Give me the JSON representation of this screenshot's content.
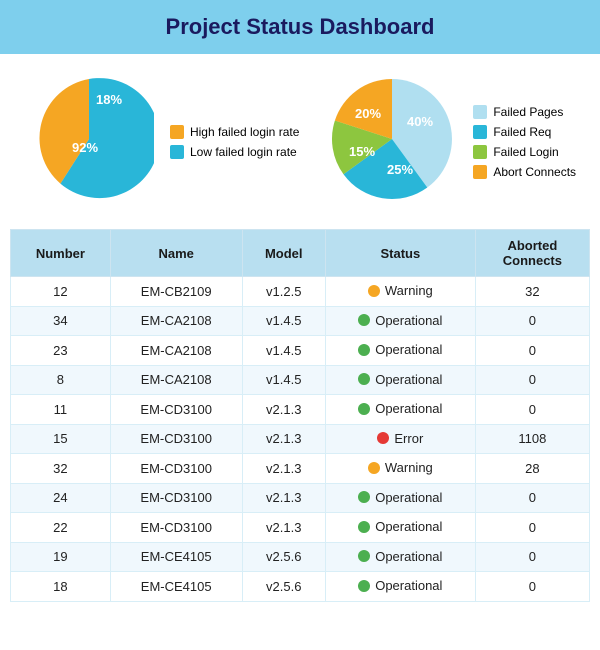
{
  "header": {
    "title": "Project Status Dashboard"
  },
  "chart1": {
    "slices": [
      {
        "label": "High failed login rate",
        "percent": 18,
        "color": "#f5a623"
      },
      {
        "label": "Low failed login rate",
        "percent": 92,
        "color": "#29b6d8"
      }
    ],
    "legend": [
      {
        "label": "High failed login rate",
        "color": "#f5a623"
      },
      {
        "label": "Low failed login rate",
        "color": "#29b6d8"
      }
    ]
  },
  "chart2": {
    "slices": [
      {
        "label": "Failed Pages",
        "percent": 40,
        "color": "#b0dff0"
      },
      {
        "label": "Failed Req",
        "percent": 25,
        "color": "#29b6d8"
      },
      {
        "label": "Failed Login",
        "percent": 15,
        "color": "#8dc63f"
      },
      {
        "label": "Abort Connects",
        "percent": 20,
        "color": "#f5a623"
      }
    ],
    "legend": [
      {
        "label": "Failed Pages",
        "color": "#b0dff0"
      },
      {
        "label": "Failed Req",
        "color": "#29b6d8"
      },
      {
        "label": "Failed Login",
        "color": "#8dc63f"
      },
      {
        "label": "Abort Connects",
        "color": "#f5a623"
      }
    ]
  },
  "table": {
    "columns": [
      "Number",
      "Name",
      "Model",
      "Status",
      "Aborted Connects"
    ],
    "rows": [
      {
        "number": 12,
        "name": "EM-CB2109",
        "model": "v1.2.5",
        "status": "Warning",
        "status_type": "warning",
        "aborted": 32
      },
      {
        "number": 34,
        "name": "EM-CA2108",
        "model": "v1.4.5",
        "status": "Operational",
        "status_type": "operational",
        "aborted": 0
      },
      {
        "number": 23,
        "name": "EM-CA2108",
        "model": "v1.4.5",
        "status": "Operational",
        "status_type": "operational",
        "aborted": 0
      },
      {
        "number": 8,
        "name": "EM-CA2108",
        "model": "v1.4.5",
        "status": "Operational",
        "status_type": "operational",
        "aborted": 0
      },
      {
        "number": 11,
        "name": "EM-CD3100",
        "model": "v2.1.3",
        "status": "Operational",
        "status_type": "operational",
        "aborted": 0
      },
      {
        "number": 15,
        "name": "EM-CD3100",
        "model": "v2.1.3",
        "status": "Error",
        "status_type": "error",
        "aborted": 1108
      },
      {
        "number": 32,
        "name": "EM-CD3100",
        "model": "v2.1.3",
        "status": "Warning",
        "status_type": "warning",
        "aborted": 28
      },
      {
        "number": 24,
        "name": "EM-CD3100",
        "model": "v2.1.3",
        "status": "Operational",
        "status_type": "operational",
        "aborted": 0
      },
      {
        "number": 22,
        "name": "EM-CD3100",
        "model": "v2.1.3",
        "status": "Operational",
        "status_type": "operational",
        "aborted": 0
      },
      {
        "number": 19,
        "name": "EM-CE4105",
        "model": "v2.5.6",
        "status": "Operational",
        "status_type": "operational",
        "aborted": 0
      },
      {
        "number": 18,
        "name": "EM-CE4105",
        "model": "v2.5.6",
        "status": "Operational",
        "status_type": "operational",
        "aborted": 0
      }
    ]
  }
}
